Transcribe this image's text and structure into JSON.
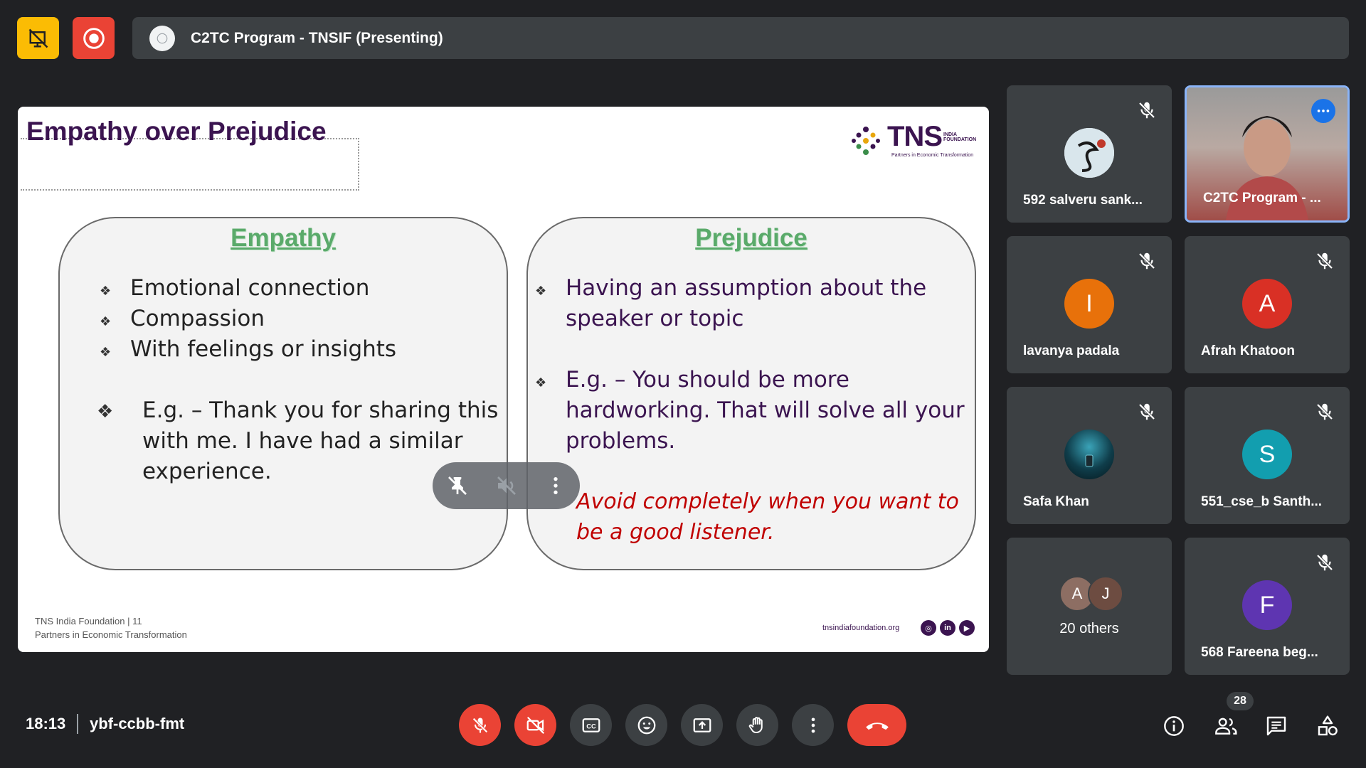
{
  "meeting": {
    "title": "C2TC Program - TNSIF (Presenting)",
    "time": "18:13",
    "code": "ybf-ccbb-fmt"
  },
  "slide": {
    "title": "Empathy over Prejudice",
    "logo_text": "TNS",
    "logo_sub_line1": "INDIA",
    "logo_sub_line2": "FOUNDATION",
    "logo_tagline": "Partners in Economic Transformation",
    "empathy": {
      "heading": "Empathy",
      "bullets": [
        "Emotional connection",
        "Compassion",
        "With feelings or insights"
      ],
      "example_lines": [
        "E.g. – Thank you for sharing this",
        "with me. I have had a similar",
        "experience."
      ]
    },
    "prejudice": {
      "heading": "Prejudice",
      "bullet_lines": [
        "Having an assumption about the",
        "speaker or topic"
      ],
      "example_lines": [
        "E.g. – You should be more",
        "hardworking. That will solve all your",
        "problems."
      ],
      "warning_lines": [
        "Avoid completely when you want to",
        "be a good listener."
      ]
    },
    "footer_org": "TNS India Foundation | 11",
    "footer_tagline": "Partners in Economic Transformation",
    "footer_site": "tnsindiafoundation.org",
    "social": [
      "instagram-icon",
      "linkedin-icon",
      "youtube-icon"
    ]
  },
  "participants": [
    {
      "name": "592 salveru sank...",
      "avatar": "image",
      "muted": true
    },
    {
      "name": "C2TC Program - ...",
      "avatar": "video",
      "muted": false
    },
    {
      "name": "lavanya padala",
      "initial": "I",
      "color": "#e8710a",
      "muted": true
    },
    {
      "name": "Afrah Khatoon",
      "initial": "A",
      "color": "#d93025",
      "muted": true
    },
    {
      "name": "Safa Khan",
      "avatar": "image",
      "muted": true
    },
    {
      "name": "551_cse_b Santh...",
      "initial": "S",
      "color": "#129eaf",
      "muted": true
    },
    {
      "name": "20 others",
      "initials": [
        "A",
        "J"
      ]
    },
    {
      "name": "568 Fareena beg...",
      "initial": "F",
      "color": "#5e35b1",
      "muted": true
    }
  ],
  "people_count": "28",
  "colors": {
    "background": "#202124",
    "tile": "#3c4043",
    "accent_red": "#ea4335",
    "accent_yellow": "#fbbc04",
    "slide_purple": "#3b1450",
    "empathy_green": "#5aaa6a",
    "warning_red": "#c00000"
  }
}
